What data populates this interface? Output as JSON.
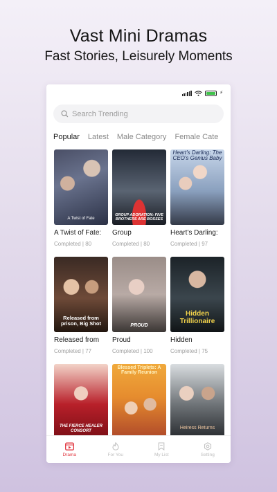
{
  "promo": {
    "title": "Vast Mini Dramas",
    "subtitle": "Fast Stories, Leisurely Moments"
  },
  "search": {
    "placeholder": "Search Trending",
    "icon": "search-icon"
  },
  "tabs": [
    {
      "label": "Popular",
      "active": true
    },
    {
      "label": "Latest",
      "active": false
    },
    {
      "label": "Male Category",
      "active": false
    },
    {
      "label": "Female Cate",
      "active": false
    }
  ],
  "dramas": [
    {
      "title": "A Twist of Fate:",
      "status": "Completed | 80",
      "cover_text": "A Twist of Fate"
    },
    {
      "title": "Group",
      "status": "Completed | 80",
      "cover_text": "GROUP ADORATION: FIVE BROTHERS ARE BOSSES"
    },
    {
      "title": "Heart's Darling:",
      "status": "Completed | 97",
      "cover_text": "Heart's Darling: The CEO's Genius Baby"
    },
    {
      "title": "Released from",
      "status": "Completed | 77",
      "cover_text": "Released from prison, Big Shot"
    },
    {
      "title": "Proud",
      "status": "Completed | 100",
      "cover_text": "PROUD"
    },
    {
      "title": "Hidden",
      "status": "Completed | 75",
      "cover_text": "Hidden Trillionaire"
    },
    {
      "cover_text": "THE FIERCE HEALER CONSORT"
    },
    {
      "cover_text": "Blessed Triplets: A Family Reunion"
    },
    {
      "cover_text": "Heiress Returns"
    }
  ],
  "nav": [
    {
      "label": "Drama",
      "icon": "drama-icon",
      "active": true
    },
    {
      "label": "For You",
      "icon": "flame-icon",
      "active": false
    },
    {
      "label": "My List",
      "icon": "bookmark-icon",
      "active": false
    },
    {
      "label": "Setting",
      "icon": "settings-icon",
      "active": false
    }
  ],
  "colors": {
    "accent": "#e0333c",
    "background_top": "#f4f0f8",
    "background_bottom": "#cfc2e0"
  }
}
